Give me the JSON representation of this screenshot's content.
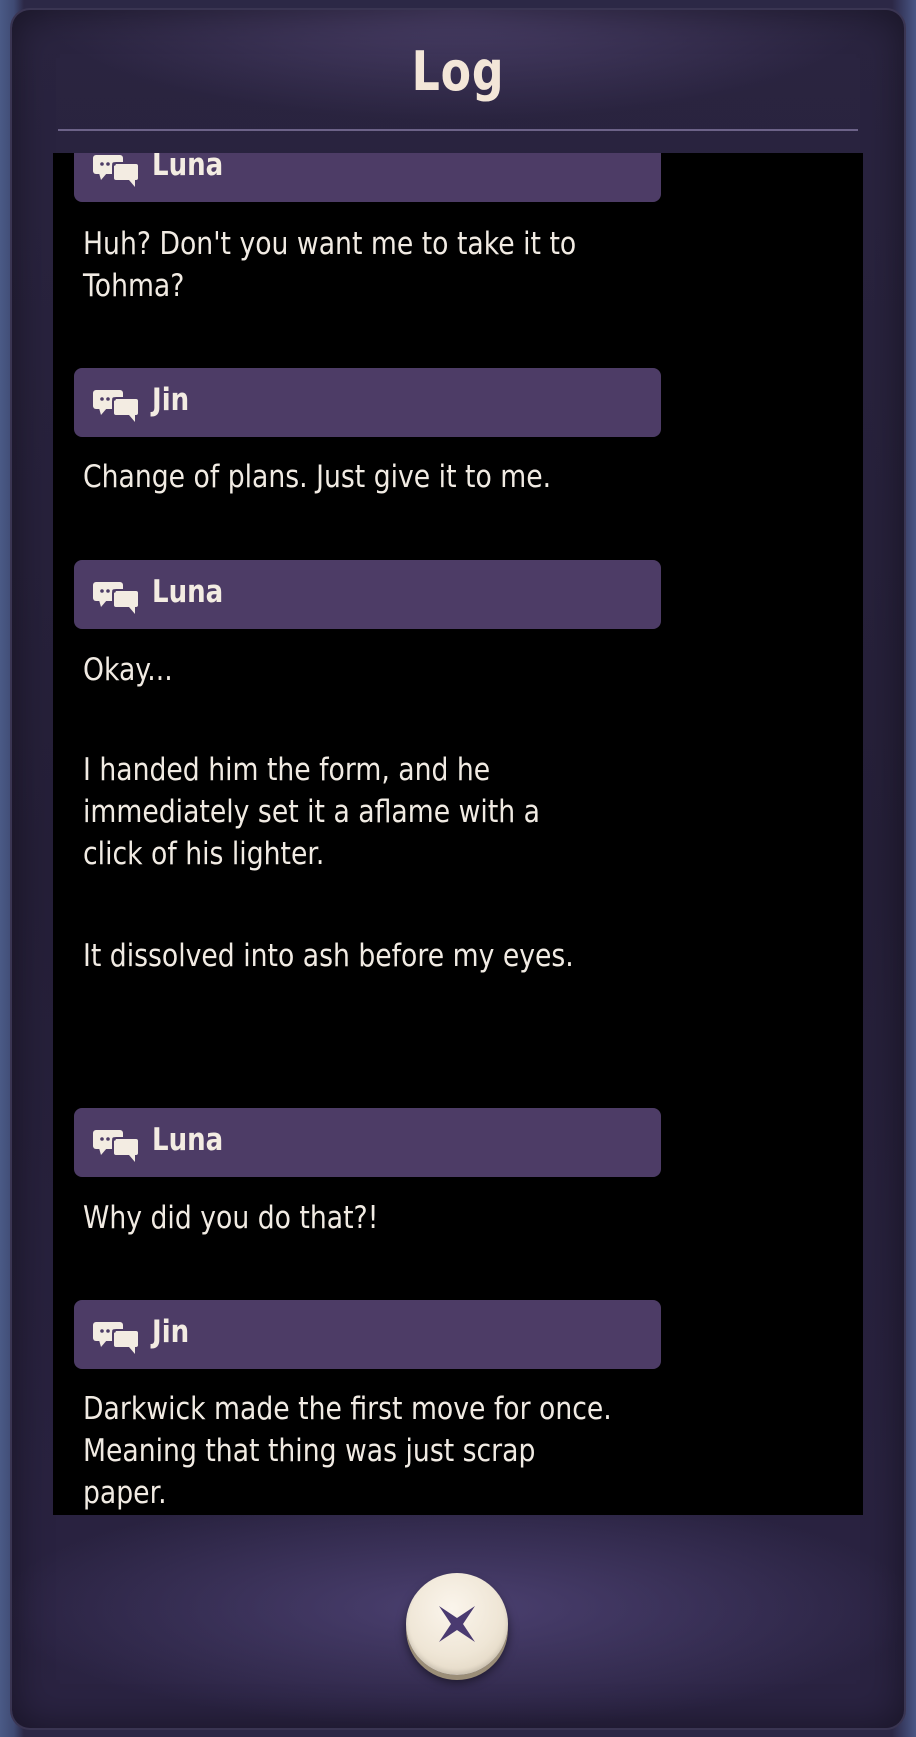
{
  "window": {
    "title": "Log"
  },
  "log": {
    "entries": [
      {
        "speaker": "Luna",
        "lines": [
          "Huh? Don't you want me to take it to",
          "Tohma?"
        ]
      },
      {
        "speaker": "Jin",
        "lines": [
          "Change of plans. Just give it to me."
        ]
      },
      {
        "speaker": "Luna",
        "lines": [
          "Okay..."
        ]
      },
      {
        "narration": [
          "I handed him the form, and he",
          "immediately set it a aflame with a",
          "click of his lighter."
        ]
      },
      {
        "narration": [
          "It dissolved into ash before my eyes."
        ]
      },
      {
        "speaker": "Luna",
        "lines": [
          "Why did you do that?!"
        ]
      },
      {
        "speaker": "Jin",
        "lines": [
          "Darkwick made the first move for once.",
          "Meaning that thing was just scrap",
          "paper."
        ]
      }
    ]
  },
  "icons": {
    "speaker": "speech-bubbles-icon",
    "close": "close-x-icon"
  },
  "colors": {
    "header_bar": "#4d3c66",
    "title_text": "#f3e6d8",
    "log_background": "#000000",
    "accent_x": "#4a3a70"
  }
}
